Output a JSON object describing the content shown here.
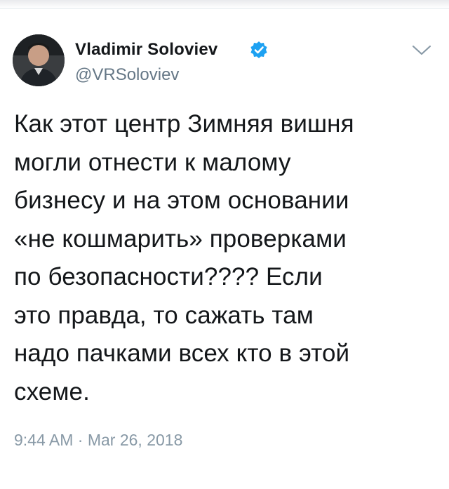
{
  "tweet": {
    "display_name": "Vladimir Soloviev",
    "handle": "@VRSoloviev",
    "text": "Как этот центр Зимняя вишня\nмогли отнести к малому\nбизнесу и на этом основании\n«не кошмарить» проверками\nпо безопасности???? Если\nэто правда, то сажать там\nнадо пачками всех кто в этой\nсхеме.",
    "time": "9:44 AM",
    "separator": "·",
    "date": "Mar 26, 2018"
  },
  "colors": {
    "verified_badge": "#1da1f2",
    "secondary_text": "#657786",
    "timestamp_text": "#8899a6",
    "primary_text": "#14171a"
  },
  "icons": {
    "verified": "verified-badge-icon",
    "menu": "chevron-down-icon"
  }
}
